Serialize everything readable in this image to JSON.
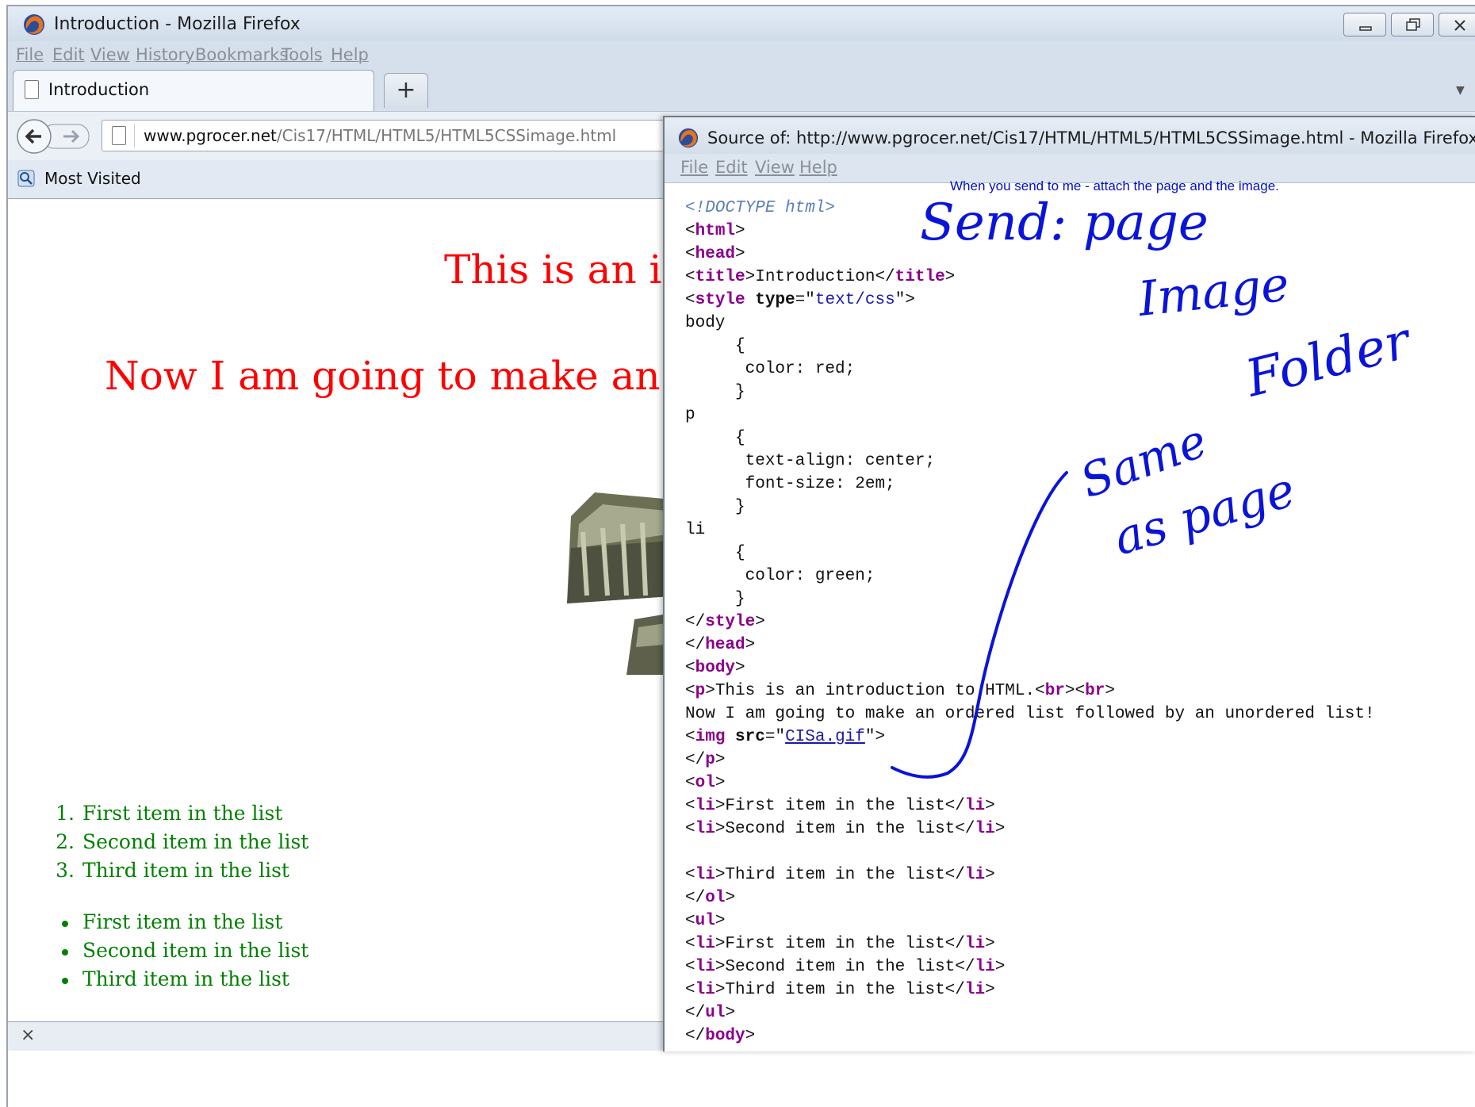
{
  "main_window": {
    "title": "Introduction - Mozilla Firefox",
    "menus": [
      "File",
      "Edit",
      "View",
      "History",
      "Bookmarks",
      "Tools",
      "Help"
    ],
    "tab_title": "Introduction",
    "new_tab_label": "+",
    "url_domain": "www.pgrocer.net",
    "url_path": "/Cis17/HTML/HTML5/HTML5CSSimage.html",
    "bookmark_label": "Most Visited",
    "findbar_close": "×"
  },
  "page": {
    "intro_line": "This is an introduction to HTML.",
    "now_line": "Now I am going to make an ordered list followed by an unordered list!",
    "ordered_list": [
      "First item in the list",
      "Second item in the list",
      "Third item in the list"
    ],
    "ordered_markers": [
      "1.",
      "2.",
      "3."
    ],
    "unordered_list": [
      "First item in the list",
      "Second item in the list",
      "Third item in the list"
    ]
  },
  "source_window": {
    "title": "Source of: http://www.pgrocer.net/Cis17/HTML/HTML5/HTML5CSSimage.html - Mozilla Firefox",
    "menus": [
      "File",
      "Edit",
      "View",
      "Help"
    ],
    "note": "When you send to me - attach the page and the image."
  },
  "handwriting": {
    "lines": [
      "Send: page",
      "Image",
      "Folder",
      "Same",
      "as page"
    ]
  },
  "colors": {
    "page_heading": "#ff0000",
    "list_text": "#008000",
    "ink": "#0a14d8",
    "tag_purple": "#8b008b",
    "attr_value_blue": "#1a1aa6"
  }
}
